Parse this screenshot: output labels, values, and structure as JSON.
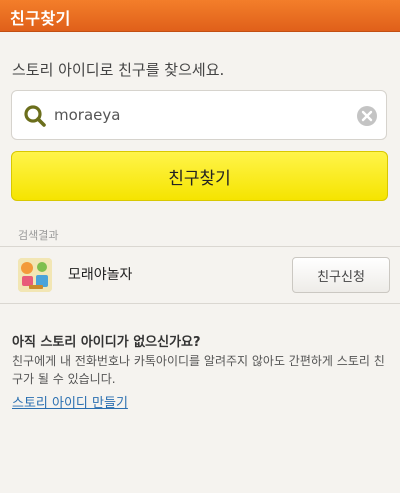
{
  "header": {
    "title": "친구찾기",
    "color": "#ea6d22"
  },
  "search": {
    "prompt": "스토리 아이디로 친구를 찾으세요.",
    "value": "moraeya",
    "search_icon": "search-icon",
    "clear_icon": "clear-icon",
    "button_label": "친구찾기",
    "button_color": "#f9ee10"
  },
  "results": {
    "label": "검색결과",
    "items": [
      {
        "name": "모래야놀자",
        "avatar_icon": "avatar-image",
        "action_label": "친구신청"
      }
    ]
  },
  "info": {
    "question": "아직 스토리 아이디가 없으신가요?",
    "description": "친구에게 내 전화번호나 카톡아이디를 알려주지 않아도 간편하게 스토리 친구가 될 수 있습니다.",
    "link_label": "스토리 아이디 만들기",
    "link_color": "#2a6fb0"
  }
}
